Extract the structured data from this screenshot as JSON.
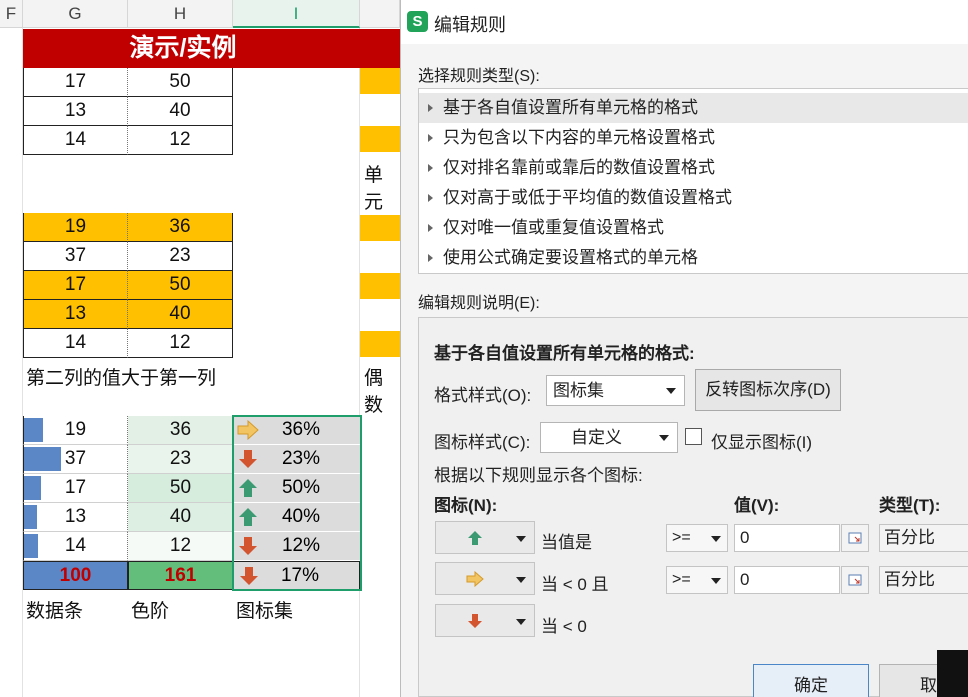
{
  "sheet": {
    "columns": [
      {
        "letter": "F"
      },
      {
        "letter": "G"
      },
      {
        "letter": "H"
      },
      {
        "letter": "I"
      }
    ],
    "banner": "演示/实例",
    "block1": [
      [
        "17",
        "50"
      ],
      [
        "13",
        "40"
      ],
      [
        "14",
        "12"
      ]
    ],
    "label_unit_partial": "单元",
    "block2": [
      [
        "19",
        "36"
      ],
      [
        "37",
        "23"
      ],
      [
        "17",
        "50"
      ],
      [
        "13",
        "40"
      ],
      [
        "14",
        "12"
      ]
    ],
    "block2_label": "第二列的值大于第一列",
    "label_even_partial": "偶数",
    "block3": {
      "rows": [
        {
          "g": "19",
          "h": "36",
          "pct": "36%",
          "icon": "arrow-right-icon",
          "bar": 0.19
        },
        {
          "g": "37",
          "h": "23",
          "pct": "23%",
          "icon": "arrow-down-icon",
          "bar": 0.37
        },
        {
          "g": "17",
          "h": "50",
          "pct": "50%",
          "icon": "arrow-up-icon",
          "bar": 0.17
        },
        {
          "g": "13",
          "h": "40",
          "pct": "40%",
          "icon": "arrow-up-icon",
          "bar": 0.13
        },
        {
          "g": "14",
          "h": "12",
          "pct": "12%",
          "icon": "arrow-down-icon",
          "bar": 0.14
        }
      ],
      "total_g": "100",
      "total_h": "161",
      "total_pct": "17%",
      "labels": [
        "数据条",
        "色阶",
        "图标集"
      ]
    }
  },
  "dialog": {
    "title": "编辑规则",
    "rule_type_label": "选择规则类型(S):",
    "rule_types": [
      "基于各自值设置所有单元格的格式",
      "只为包含以下内容的单元格设置格式",
      "仅对排名靠前或靠后的数值设置格式",
      "仅对高于或低于平均值的数值设置格式",
      "仅对唯一值或重复值设置格式",
      "使用公式确定要设置格式的单元格"
    ],
    "edit_desc_label": "编辑规则说明(E):",
    "panel_heading": "基于各自值设置所有单元格的格式:",
    "format_style_label": "格式样式(O):",
    "format_style_value": "图标集",
    "reverse_button": "反转图标次序(D)",
    "icon_style_label": "图标样式(C):",
    "icon_style_value": "自定义",
    "show_icon_only": "仅显示图标(I)",
    "rule_hint": "根据以下规则显示各个图标:",
    "col_icon": "图标(N):",
    "col_value": "值(V):",
    "col_type": "类型(T):",
    "rules": [
      {
        "icon": "green-up-arrow-icon",
        "cond": "当值是",
        "op": ">=",
        "value": "0",
        "type": "百分比"
      },
      {
        "icon": "yellow-right-arrow-icon",
        "cond": "当 < 0 且",
        "op": ">=",
        "value": "0",
        "type": "百分比"
      },
      {
        "icon": "red-down-arrow-icon",
        "cond": "当 < 0"
      }
    ],
    "ok": "确定",
    "cancel": "取"
  },
  "colors": {
    "accent_green": "#1f9e6c",
    "banner_red": "#c00000",
    "highlight": "#ffc000",
    "bar_blue": "#5b87c7"
  }
}
